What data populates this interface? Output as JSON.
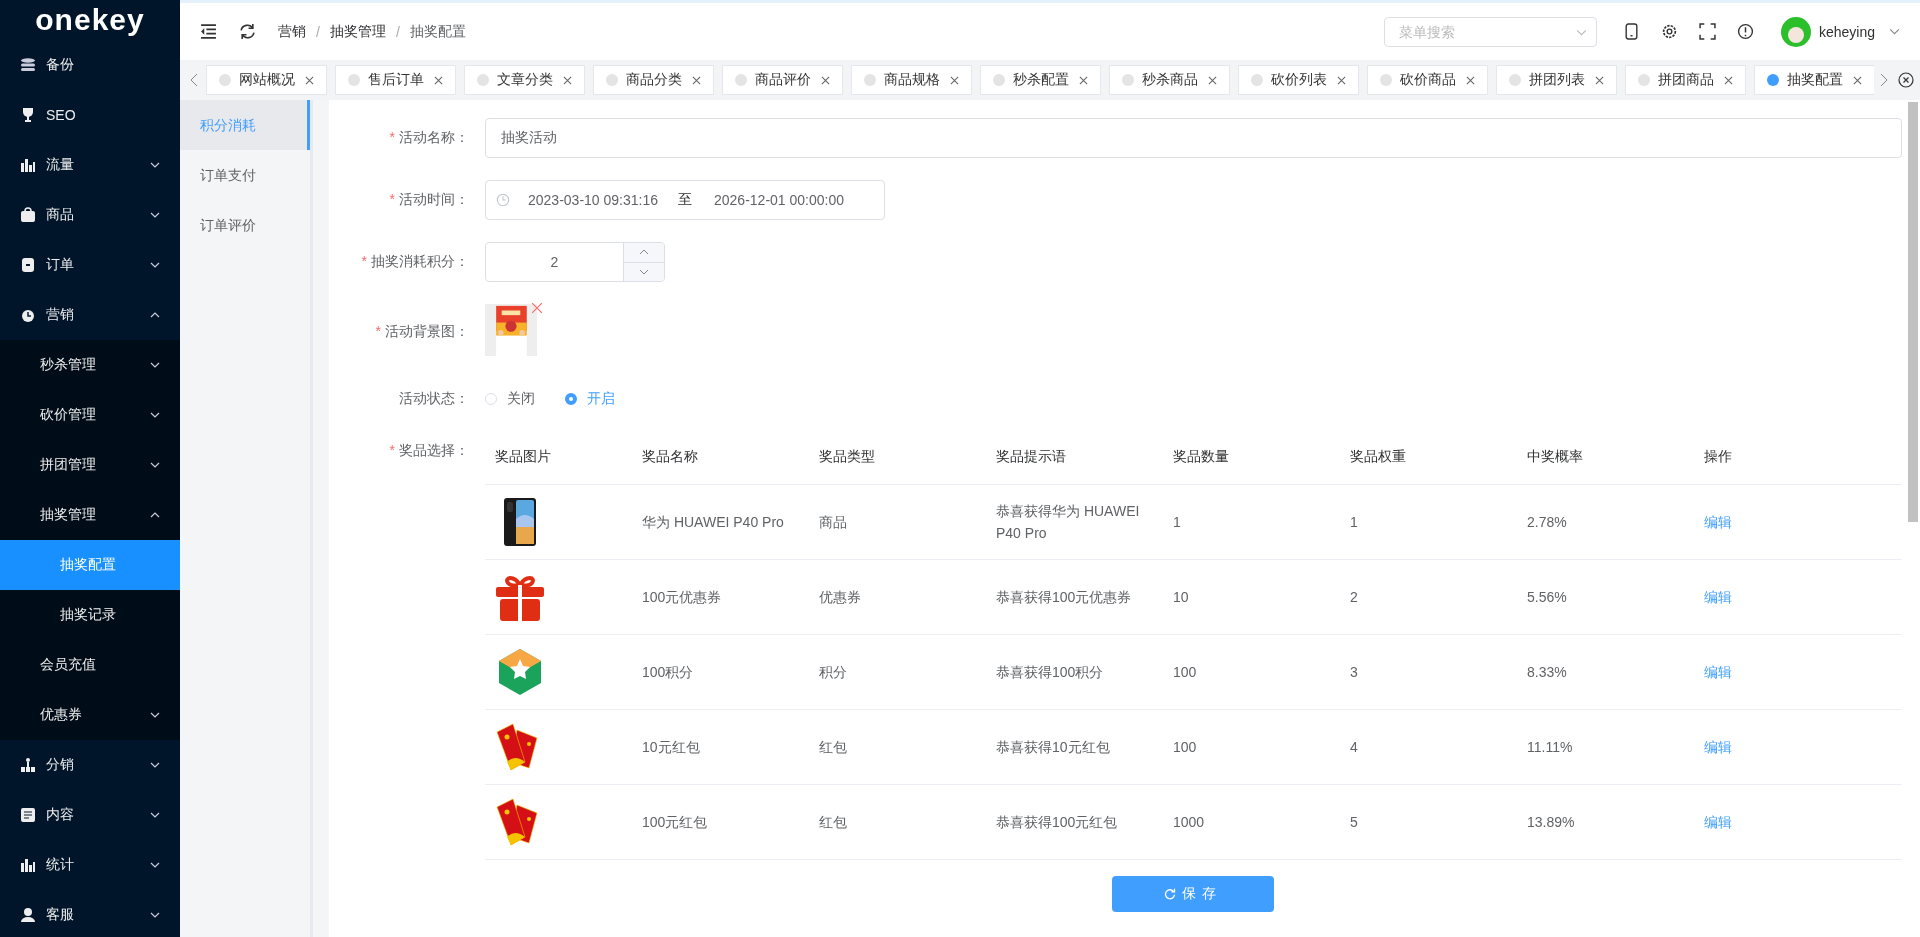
{
  "logo": "onekey",
  "header": {
    "breadcrumb": [
      "营销",
      "抽奖管理",
      "抽奖配置"
    ],
    "breadcrumb_separator": "/",
    "search": {
      "placeholder": "菜单搜索"
    },
    "user": "keheying"
  },
  "sidebar": {
    "items": [
      {
        "label": "备份",
        "selected": false
      },
      {
        "label": "SEO",
        "selected": false
      },
      {
        "label": "流量",
        "selected": false,
        "expanded": false
      },
      {
        "label": "商品",
        "selected": false,
        "expanded": false
      },
      {
        "label": "订单",
        "selected": false,
        "expanded": false
      },
      {
        "label": "营销",
        "selected": false,
        "expanded": true,
        "children": [
          {
            "label": "秒杀管理",
            "selected": false,
            "expanded": false
          },
          {
            "label": "砍价管理",
            "selected": false,
            "expanded": false
          },
          {
            "label": "拼团管理",
            "selected": false,
            "expanded": false
          },
          {
            "label": "抽奖管理",
            "selected": false,
            "expanded": true,
            "children": [
              {
                "label": "抽奖配置",
                "selected": true
              },
              {
                "label": "抽奖记录",
                "selected": false
              }
            ]
          },
          {
            "label": "会员充值",
            "selected": false
          },
          {
            "label": "优惠券",
            "selected": false,
            "expanded": false
          }
        ]
      },
      {
        "label": "分销",
        "selected": false,
        "expanded": false
      },
      {
        "label": "内容",
        "selected": false,
        "expanded": false
      },
      {
        "label": "统计",
        "selected": false,
        "expanded": false
      },
      {
        "label": "客服",
        "selected": false,
        "expanded": false
      }
    ]
  },
  "tabs": [
    {
      "label": "网站概况",
      "selected": false
    },
    {
      "label": "售后订单",
      "selected": false
    },
    {
      "label": "文章分类",
      "selected": false
    },
    {
      "label": "商品分类",
      "selected": false
    },
    {
      "label": "商品评价",
      "selected": false
    },
    {
      "label": "商品规格",
      "selected": false
    },
    {
      "label": "秒杀配置",
      "selected": false
    },
    {
      "label": "秒杀商品",
      "selected": false
    },
    {
      "label": "砍价列表",
      "selected": false
    },
    {
      "label": "砍价商品",
      "selected": false
    },
    {
      "label": "拼团列表",
      "selected": false
    },
    {
      "label": "拼团商品",
      "selected": false
    },
    {
      "label": "抽奖配置",
      "selected": true
    }
  ],
  "submenu": {
    "items": [
      {
        "label": "积分消耗",
        "selected": true
      },
      {
        "label": "订单支付",
        "selected": false
      },
      {
        "label": "订单评价",
        "selected": false
      }
    ]
  },
  "form": {
    "name": {
      "mark": "*",
      "label": "活动名称：",
      "value": "抽奖活动"
    },
    "time": {
      "mark": "*",
      "label": "活动时间：",
      "start": "2023-03-10 09:31:16",
      "separator": "至",
      "end": "2026-12-01 00:00:00"
    },
    "points": {
      "mark": "*",
      "label": "抽奖消耗积分：",
      "value": "2"
    },
    "background": {
      "mark": "*",
      "label": "活动背景图：",
      "kind": "picture"
    },
    "status": {
      "label": "活动状态：",
      "options": [
        {
          "label": "关闭",
          "selected": false
        },
        {
          "label": "开启",
          "selected": true
        }
      ]
    },
    "prizes": {
      "mark": "*",
      "label": "奖品选择：",
      "columns": [
        "奖品图片",
        "奖品名称",
        "奖品类型",
        "奖品提示语",
        "奖品数量",
        "奖品权重",
        "中奖概率",
        "操作"
      ],
      "rows": [
        {
          "kind": "phone",
          "name": "华为 HUAWEI P40 Pro",
          "type": "商品",
          "hint": "恭喜获得华为 HUAWEI P40 Pro",
          "quantity": "1",
          "weight": "1",
          "probability": "2.78%",
          "action": "编辑"
        },
        {
          "kind": "gift",
          "name": "100元优惠券",
          "type": "优惠券",
          "hint": "恭喜获得100元优惠券",
          "quantity": "10",
          "weight": "2",
          "probability": "5.56%",
          "action": "编辑"
        },
        {
          "kind": "points",
          "name": "100积分",
          "type": "积分",
          "hint": "恭喜获得100积分",
          "quantity": "100",
          "weight": "3",
          "probability": "8.33%",
          "action": "编辑"
        },
        {
          "kind": "envelope",
          "name": "10元红包",
          "type": "红包",
          "hint": "恭喜获得10元红包",
          "quantity": "100",
          "weight": "4",
          "probability": "11.11%",
          "action": "编辑"
        },
        {
          "kind": "envelope",
          "name": "100元红包",
          "type": "红包",
          "hint": "恭喜获得100元红包",
          "quantity": "1000",
          "weight": "5",
          "probability": "13.89%",
          "action": "编辑"
        }
      ]
    }
  },
  "save_button": "保存"
}
